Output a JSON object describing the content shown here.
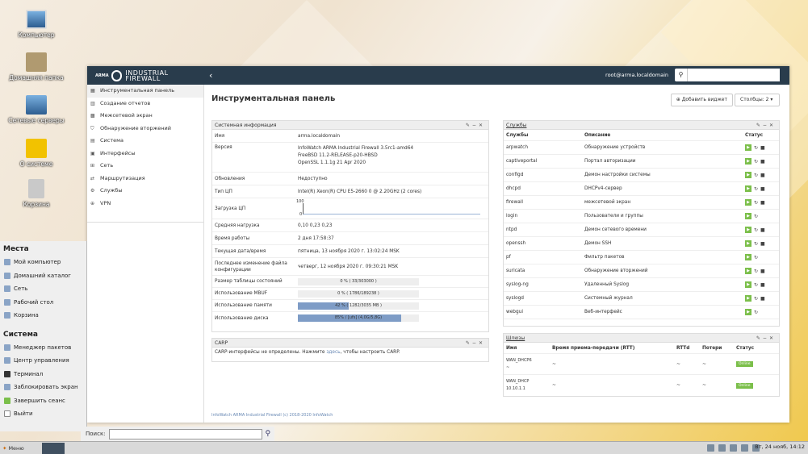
{
  "desktop": {
    "icons": [
      "Компьютер",
      "Домашняя папка",
      "Сетевые серверы",
      "О системе",
      "Корзина"
    ]
  },
  "app": {
    "brand_small": "ARMA",
    "brand": "INDUSTRIAL FIREWALL",
    "user": "root@arma.localdomain",
    "search_placeholder": ""
  },
  "sidebar": {
    "items": [
      {
        "label": "Инструментальная панель",
        "icon": "dashboard-icon"
      },
      {
        "label": "Создание отчетов",
        "icon": "report-icon"
      },
      {
        "label": "Межсетевой экран",
        "icon": "firewall-icon"
      },
      {
        "label": "Обнаружение вторжений",
        "icon": "shield-icon"
      },
      {
        "label": "Система",
        "icon": "system-icon"
      },
      {
        "label": "Интерфейсы",
        "icon": "interfaces-icon"
      },
      {
        "label": "Сеть",
        "icon": "network-icon"
      },
      {
        "label": "Маршрутизация",
        "icon": "routing-icon"
      },
      {
        "label": "Службы",
        "icon": "services-icon"
      },
      {
        "label": "VPN",
        "icon": "vpn-icon"
      }
    ]
  },
  "main": {
    "title": "Инструментальная панель",
    "add_widget": "Добавить виджет",
    "columns": "Столбцы: 2",
    "footer": "InfoWatch ARMA Industrial Firewall (c) 2018-2020 InfoWatch"
  },
  "sysinfo": {
    "title": "Системная информация",
    "rows": [
      {
        "k": "Имя",
        "v": "arma.localdomain"
      },
      {
        "k": "Версия",
        "v": "InfoWatch ARMA Industrial Firewall 3.5rc1-amd64"
      },
      {
        "k": "",
        "v": "FreeBSD 11.2-RELEASE-p20-HBSD"
      },
      {
        "k": "",
        "v": "OpenSSL 1.1.1g 21 Apr 2020"
      },
      {
        "k": "Обновления",
        "v": "Недоступно"
      },
      {
        "k": "Тип ЦП",
        "v": "Intel(R) Xeon(R) CPU E5-2660 0 @ 2.20GHz (2 cores)"
      },
      {
        "k": "Загрузка ЦП",
        "v": ""
      },
      {
        "k": "Средняя нагрузка",
        "v": "0,10 0,23 0,23"
      },
      {
        "k": "Время работы",
        "v": "2 дня 17:58:37"
      },
      {
        "k": "Текущая дата/время",
        "v": "пятница, 13 ноября 2020 г. 13:02:24 MSK"
      },
      {
        "k": "Последнее изменение файла конфигурации",
        "v": "четверг, 12 ноября 2020 г. 09:30:21 MSK"
      }
    ],
    "cpu_max": "100",
    "cpu_min": "0",
    "bars": [
      {
        "k": "Размер таблицы состояний",
        "label": "0 % ( 33/303000 )",
        "pct": 0
      },
      {
        "k": "Использование MBUF",
        "label": "0 % ( 1786/189238 )",
        "pct": 0
      },
      {
        "k": "Использование памяти",
        "label": "42 % ( 1282/3035 MB )",
        "pct": 42
      },
      {
        "k": "Использование диска",
        "label": "85% / [ufs] (4,0G/5,8G)",
        "pct": 85
      }
    ]
  },
  "carp": {
    "title": "CARP",
    "text_before": "CARP-интерфейсы не определены. Нажмите ",
    "link": "здесь",
    "text_after": ", чтобы настроить CARP."
  },
  "services": {
    "title": "Службы",
    "headers": [
      "Службы",
      "Описание",
      "Статус"
    ],
    "rows": [
      {
        "n": "arpwatch",
        "d": "Обнаружение устройств"
      },
      {
        "n": "captiveportal",
        "d": "Портал авторизации"
      },
      {
        "n": "configd",
        "d": "Демон настройки системы"
      },
      {
        "n": "dhcpd",
        "d": "DHCPv4-сервер"
      },
      {
        "n": "firewall",
        "d": "межсетевой экран"
      },
      {
        "n": "login",
        "d": "Пользователи и группы"
      },
      {
        "n": "ntpd",
        "d": "Демон сетевого времени"
      },
      {
        "n": "openssh",
        "d": "Демон SSH"
      },
      {
        "n": "pf",
        "d": "Фильтр пакетов"
      },
      {
        "n": "suricata",
        "d": "Обнаружение вторжений"
      },
      {
        "n": "syslog-ng",
        "d": "Удаленный Syslog"
      },
      {
        "n": "syslogd",
        "d": "Системный журнал"
      },
      {
        "n": "webgui",
        "d": "Веб-интерфейс"
      }
    ]
  },
  "gateways": {
    "title": "Шлюзы",
    "headers": [
      "Имя",
      "Время приема-передачи (RTT)",
      "RTTd",
      "Потери",
      "Статус"
    ],
    "rows": [
      {
        "n": "WAN_DHCP6",
        "ip": "~",
        "rtt": "~",
        "rttd": "~",
        "loss": "~",
        "status": "Online"
      },
      {
        "n": "WAN_DHCP",
        "ip": "10.10.1.1",
        "rtt": "~",
        "rttd": "~",
        "loss": "~",
        "status": "Online"
      }
    ]
  },
  "startmenu": {
    "places_title": "Места",
    "places": [
      "Мой компьютер",
      "Домашний каталог",
      "Сеть",
      "Рабочий стол",
      "Корзина"
    ],
    "system_title": "Система",
    "system": [
      "Менеджер пакетов",
      "Центр управления",
      "Терминал",
      "Заблокировать экран",
      "Завершить сеанс",
      "Выйти"
    ],
    "search_label": "Поиск:"
  },
  "taskbar": {
    "menu": "Меню",
    "clock": "Вт, 24 нояб, 14:12"
  }
}
